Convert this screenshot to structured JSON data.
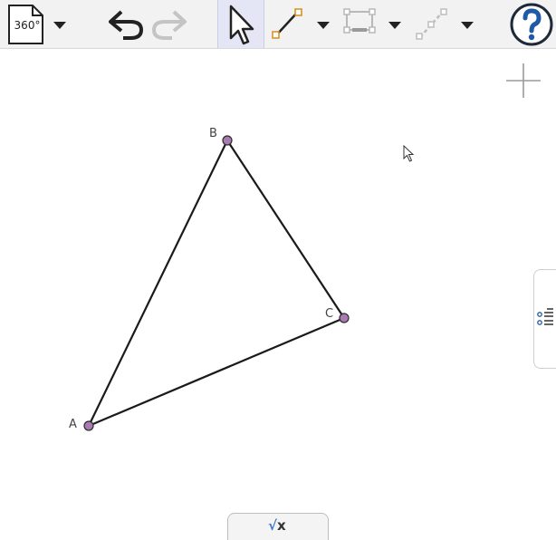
{
  "toolbar": {
    "file_menu_label": "360°",
    "tools": [
      "file-menu",
      "undo",
      "redo",
      "move-tool",
      "segment-tool",
      "polygon-tool",
      "ray-tool",
      "help"
    ]
  },
  "points": {
    "a_label": "A",
    "b_label": "B",
    "c_label": "C"
  },
  "input_bar": {
    "symbol_root": "√",
    "symbol_var": "x"
  },
  "colors": {
    "point_fill": "#a97bb2",
    "segment": "#1a1a1a",
    "accent": "#d98b1a",
    "help": "#1e5aa6"
  }
}
